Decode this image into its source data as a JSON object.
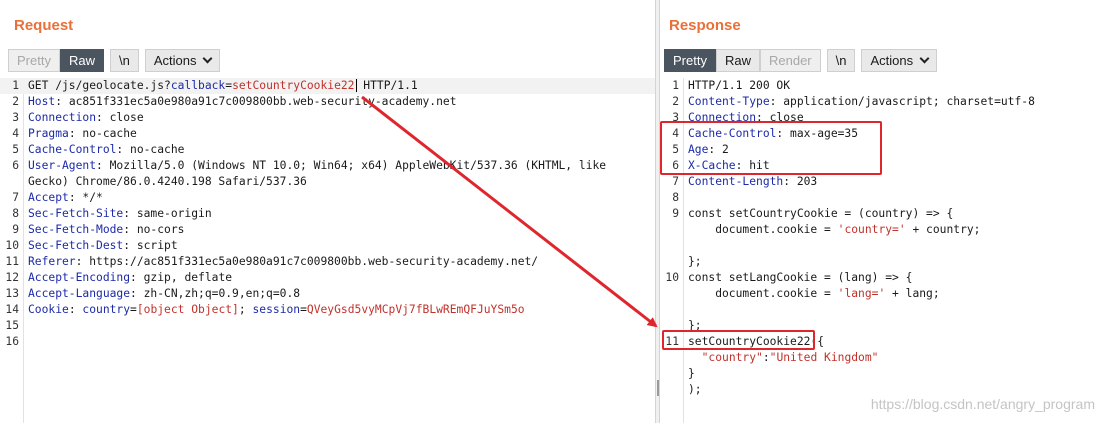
{
  "request": {
    "title": "Request",
    "tabs": [
      "Pretty",
      "Raw",
      "\\n",
      "Actions"
    ],
    "active_tab": "Raw",
    "lines": [
      {
        "n": "1",
        "segs": [
          [
            "v",
            "GET /js/geolocate.js?"
          ],
          [
            "k",
            "callback"
          ],
          [
            "v",
            "="
          ],
          [
            "r",
            "setCountryCookie22"
          ],
          [
            "cur",
            ""
          ],
          [
            "v",
            " HTTP/1.1"
          ]
        ]
      },
      {
        "n": "2",
        "segs": [
          [
            "k",
            "Host"
          ],
          [
            "v",
            ": ac851f331ec5a0e980a91c7c009800bb.web-security-academy.net"
          ]
        ]
      },
      {
        "n": "3",
        "segs": [
          [
            "k",
            "Connection"
          ],
          [
            "v",
            ": close"
          ]
        ]
      },
      {
        "n": "4",
        "segs": [
          [
            "k",
            "Pragma"
          ],
          [
            "v",
            ": no-cache"
          ]
        ]
      },
      {
        "n": "5",
        "segs": [
          [
            "k",
            "Cache-Control"
          ],
          [
            "v",
            ": no-cache"
          ]
        ]
      },
      {
        "n": "6",
        "segs": [
          [
            "k",
            "User-Agent"
          ],
          [
            "v",
            ": Mozilla/5.0 (Windows NT 10.0; Win64; x64) AppleWebKit/537.36 (KHTML, like"
          ]
        ]
      },
      {
        "n": "",
        "segs": [
          [
            "v",
            "Gecko) Chrome/86.0.4240.198 Safari/537.36"
          ]
        ]
      },
      {
        "n": "7",
        "segs": [
          [
            "k",
            "Accept"
          ],
          [
            "v",
            ": */*"
          ]
        ]
      },
      {
        "n": "8",
        "segs": [
          [
            "k",
            "Sec-Fetch-Site"
          ],
          [
            "v",
            ": same-origin"
          ]
        ]
      },
      {
        "n": "9",
        "segs": [
          [
            "k",
            "Sec-Fetch-Mode"
          ],
          [
            "v",
            ": no-cors"
          ]
        ]
      },
      {
        "n": "10",
        "segs": [
          [
            "k",
            "Sec-Fetch-Dest"
          ],
          [
            "v",
            ": script"
          ]
        ]
      },
      {
        "n": "11",
        "segs": [
          [
            "k",
            "Referer"
          ],
          [
            "v",
            ": https://ac851f331ec5a0e980a91c7c009800bb.web-security-academy.net/"
          ]
        ]
      },
      {
        "n": "12",
        "segs": [
          [
            "k",
            "Accept-Encoding"
          ],
          [
            "v",
            ": gzip, deflate"
          ]
        ]
      },
      {
        "n": "13",
        "segs": [
          [
            "k",
            "Accept-Language"
          ],
          [
            "v",
            ": zh-CN,zh;q=0.9,en;q=0.8"
          ]
        ]
      },
      {
        "n": "14",
        "segs": [
          [
            "k",
            "Cookie"
          ],
          [
            "v",
            ": "
          ],
          [
            "k",
            "country"
          ],
          [
            "v",
            "="
          ],
          [
            "r",
            "[object Object]"
          ],
          [
            "v",
            "; "
          ],
          [
            "k",
            "session"
          ],
          [
            "v",
            "="
          ],
          [
            "r",
            "QVeyGsd5vyMCpVj7fBLwREmQFJuYSm5o"
          ]
        ]
      },
      {
        "n": "15",
        "segs": []
      },
      {
        "n": "16",
        "segs": []
      }
    ]
  },
  "response": {
    "title": "Response",
    "tabs": [
      "Pretty",
      "Raw",
      "Render",
      "\\n",
      "Actions"
    ],
    "active_tab": "Pretty",
    "disabled_tabs": [
      "Render"
    ],
    "lines": [
      {
        "n": "1",
        "segs": [
          [
            "v",
            "HTTP/1.1 200 OK"
          ]
        ]
      },
      {
        "n": "2",
        "segs": [
          [
            "k",
            "Content-Type"
          ],
          [
            "v",
            ": application/javascript; charset=utf-8"
          ]
        ]
      },
      {
        "n": "3",
        "segs": [
          [
            "k",
            "Connection"
          ],
          [
            "v",
            ": close"
          ]
        ]
      },
      {
        "n": "4",
        "segs": [
          [
            "k",
            "Cache-Control"
          ],
          [
            "v",
            ": max-age=35"
          ]
        ]
      },
      {
        "n": "5",
        "segs": [
          [
            "k",
            "Age"
          ],
          [
            "v",
            ": 2"
          ]
        ]
      },
      {
        "n": "6",
        "segs": [
          [
            "k",
            "X-Cache"
          ],
          [
            "v",
            ": hit"
          ]
        ]
      },
      {
        "n": "7",
        "segs": [
          [
            "k",
            "Content-Length"
          ],
          [
            "v",
            ": 203"
          ]
        ]
      },
      {
        "n": "8",
        "segs": []
      },
      {
        "n": "9",
        "segs": [
          [
            "v",
            "const setCountryCookie = (country) => {"
          ]
        ]
      },
      {
        "n": "",
        "segs": [
          [
            "v",
            "    document.cookie = "
          ],
          [
            "s",
            "'country='"
          ],
          [
            "v",
            " + country;"
          ]
        ]
      },
      {
        "n": "",
        "segs": []
      },
      {
        "n": "",
        "segs": [
          [
            "v",
            "};"
          ]
        ]
      },
      {
        "n": "10",
        "segs": [
          [
            "v",
            "const setLangCookie = (lang) => {"
          ]
        ]
      },
      {
        "n": "",
        "segs": [
          [
            "v",
            "    document.cookie = "
          ],
          [
            "s",
            "'lang='"
          ],
          [
            "v",
            " + lang;"
          ]
        ]
      },
      {
        "n": "",
        "segs": []
      },
      {
        "n": "",
        "segs": [
          [
            "v",
            "};"
          ]
        ]
      },
      {
        "n": "11",
        "segs": [
          [
            "v",
            "setCountryCookie22({"
          ]
        ]
      },
      {
        "n": "",
        "segs": [
          [
            "v",
            "  "
          ],
          [
            "s",
            "\"country\""
          ],
          [
            "v",
            ":"
          ],
          [
            "s",
            "\"United Kingdom\""
          ]
        ]
      },
      {
        "n": "",
        "segs": [
          [
            "v",
            "}"
          ]
        ]
      },
      {
        "n": "",
        "segs": [
          [
            "v",
            ");"
          ]
        ]
      }
    ]
  },
  "watermark": "https://blog.csdn.net/angry_program",
  "colors": {
    "accent": "#e8703a",
    "annotation": "#e0262d",
    "header_key": "#1c2aa8",
    "value_red": "#c0322b"
  }
}
